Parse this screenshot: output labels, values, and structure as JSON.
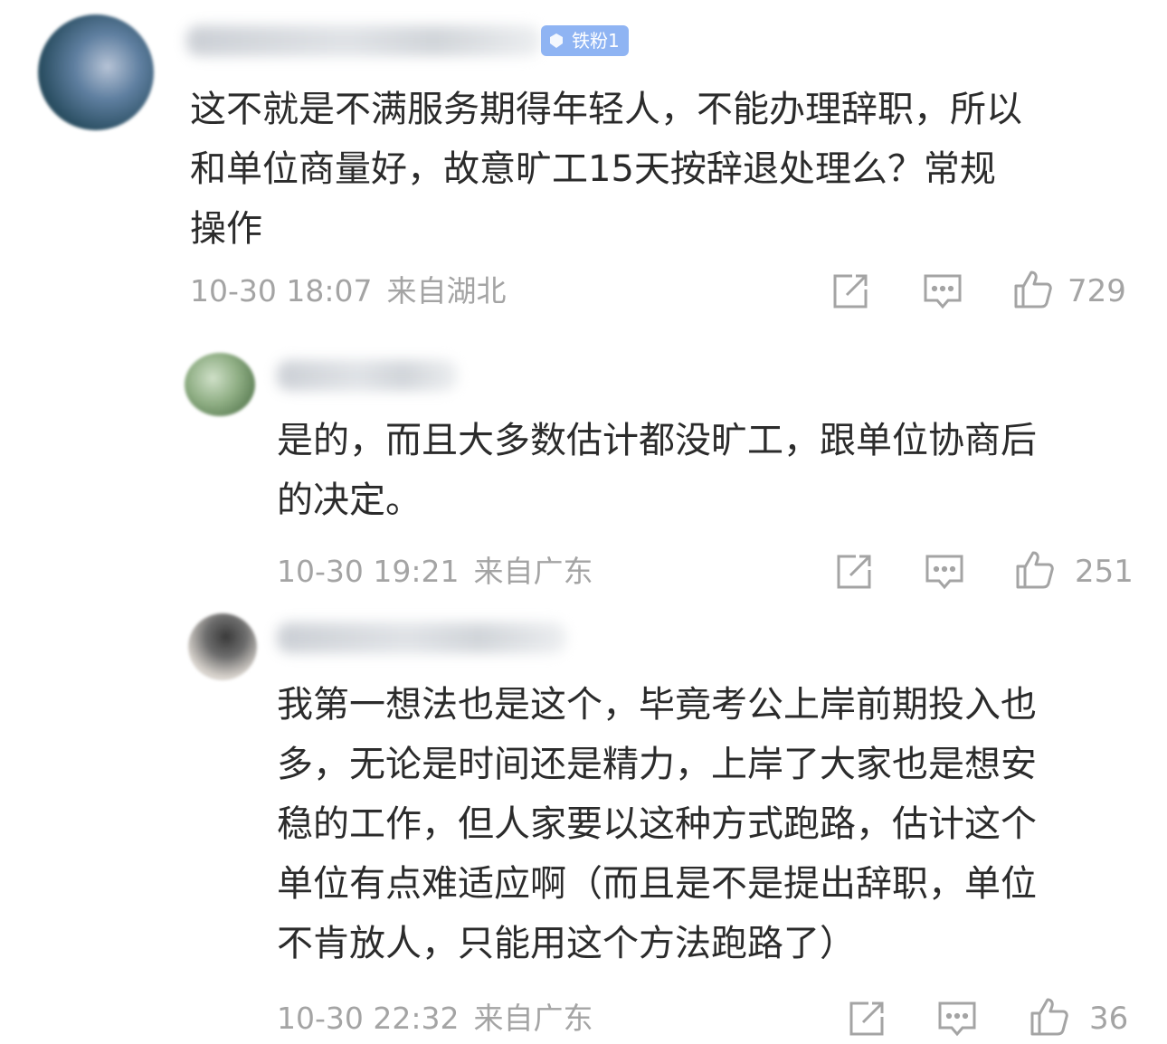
{
  "comments": [
    {
      "badge": "铁粉1",
      "lines": [
        "这不就是不满服务期得年轻人，不能办理辞职，所以",
        "和单位商量好，故意旷工15天按辞退处理么？常规",
        "操作"
      ],
      "time": "10-30 18:07",
      "location": "来自湖北",
      "likes": "729"
    },
    {
      "lines": [
        "是的，而且大多数估计都没旷工，跟单位协商后",
        "的决定。"
      ],
      "time": "10-30 19:21",
      "location": "来自广东",
      "likes": "251"
    },
    {
      "lines": [
        "我第一想法也是这个，毕竟考公上岸前期投入也",
        "多，无论是时间还是精力，上岸了大家也是想安",
        "稳的工作，但人家要以这种方式跑路，估计这个",
        "单位有点难适应啊（而且是不是提出辞职，单位",
        "不肯放人，只能用这个方法跑路了）"
      ],
      "time": "10-30 22:32",
      "location": "来自广东",
      "likes": "36"
    }
  ],
  "icons": {
    "share": "share-icon",
    "reply": "comment-icon",
    "like": "thumbs-up-icon"
  },
  "colors": {
    "text": "#2b2b2b",
    "meta": "#a4a4a4",
    "badge": "#8fb4f3"
  }
}
